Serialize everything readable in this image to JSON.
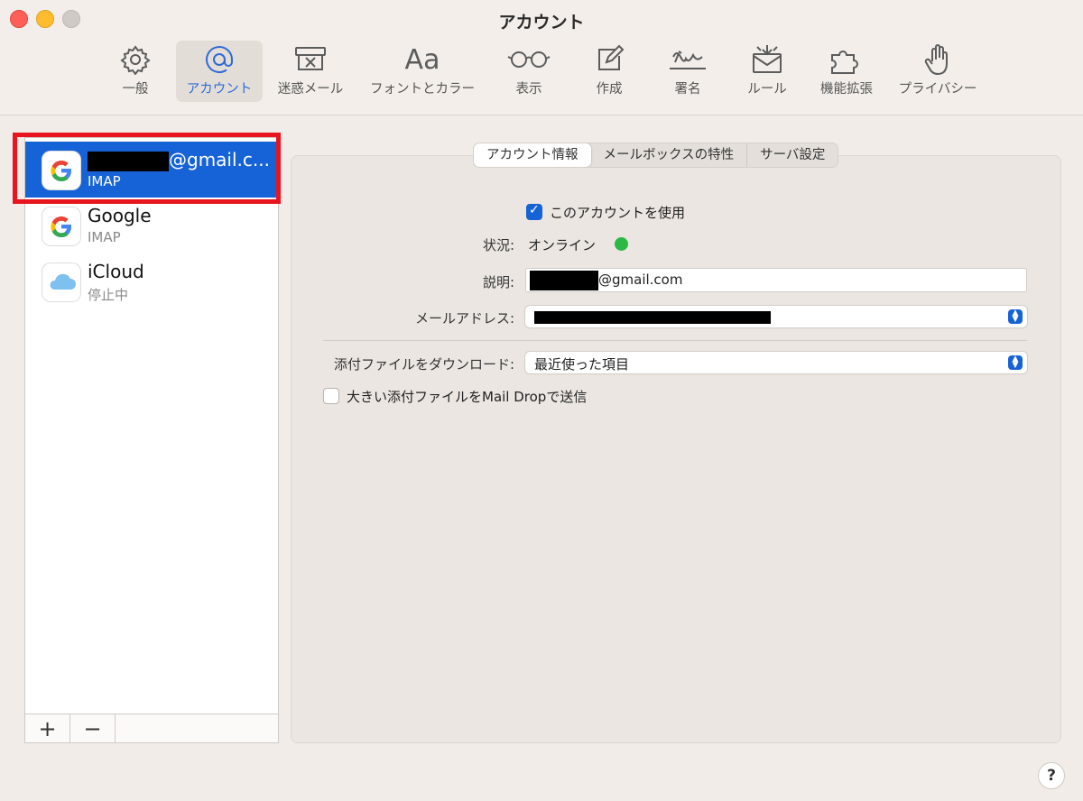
{
  "window": {
    "title": "アカウント"
  },
  "toolbar": {
    "items": [
      {
        "label": "一般",
        "icon": "gear-icon"
      },
      {
        "label": "アカウント",
        "icon": "at-icon"
      },
      {
        "label": "迷惑メール",
        "icon": "junk-icon"
      },
      {
        "label": "フォントとカラー",
        "icon": "font-icon"
      },
      {
        "label": "表示",
        "icon": "glasses-icon"
      },
      {
        "label": "作成",
        "icon": "compose-icon"
      },
      {
        "label": "署名",
        "icon": "signature-icon"
      },
      {
        "label": "ルール",
        "icon": "rules-icon"
      },
      {
        "label": "機能拡張",
        "icon": "extension-icon"
      },
      {
        "label": "プライバシー",
        "icon": "privacy-icon"
      }
    ],
    "active_index": 1,
    "font_glyph": "Aa"
  },
  "accounts": [
    {
      "name_suffix": "@gmail.c...",
      "type": "IMAP",
      "icon": "google-icon",
      "selected": true
    },
    {
      "name": "Google",
      "type": "IMAP",
      "icon": "google-icon"
    },
    {
      "name": "iCloud",
      "type": "停止中",
      "icon": "icloud-icon"
    }
  ],
  "sidebar_buttons": {
    "add": "+",
    "remove": "−"
  },
  "tabs": [
    "アカウント情報",
    "メールボックスの特性",
    "サーバ設定"
  ],
  "form": {
    "enable_label": "このアカウントを使用",
    "status_label": "状況:",
    "status_value": "オンライン",
    "description_label": "説明:",
    "description_suffix": "@gmail.com",
    "email_label": "メールアドレス:",
    "download_label": "添付ファイルをダウンロード:",
    "download_value": "最近使った項目",
    "maildrop_label": "大きい添付ファイルをMail Dropで送信"
  },
  "help": "?",
  "colors": {
    "accent": "#1663d8",
    "highlight": "#e8141e",
    "online": "#2bb845"
  }
}
